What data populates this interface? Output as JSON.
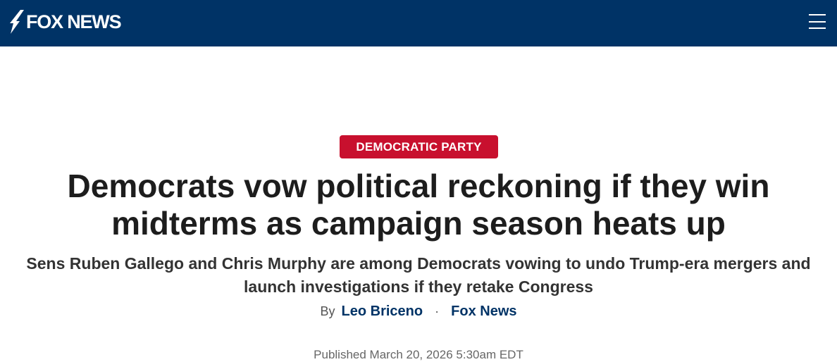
{
  "header": {
    "logo_text": "FOX NEWS",
    "background_color": "#003366"
  },
  "menu": {
    "icon": "hamburger-menu-icon"
  },
  "article": {
    "category": "DEMOCRATIC PARTY",
    "category_color": "#c8102e",
    "headline": "Democrats vow political reckoning if they win midterms as campaign season heats up",
    "subheadline": "Sens Ruben Gallego and Chris Murphy are among Democrats vowing to undo Trump-era mergers and launch investigations if they retake Congress",
    "byline": {
      "prefix": "By",
      "author": "Leo Briceno",
      "separator": "·",
      "outlet": "Fox News"
    },
    "published": "Published March 20, 2026 5:30am EDT"
  }
}
